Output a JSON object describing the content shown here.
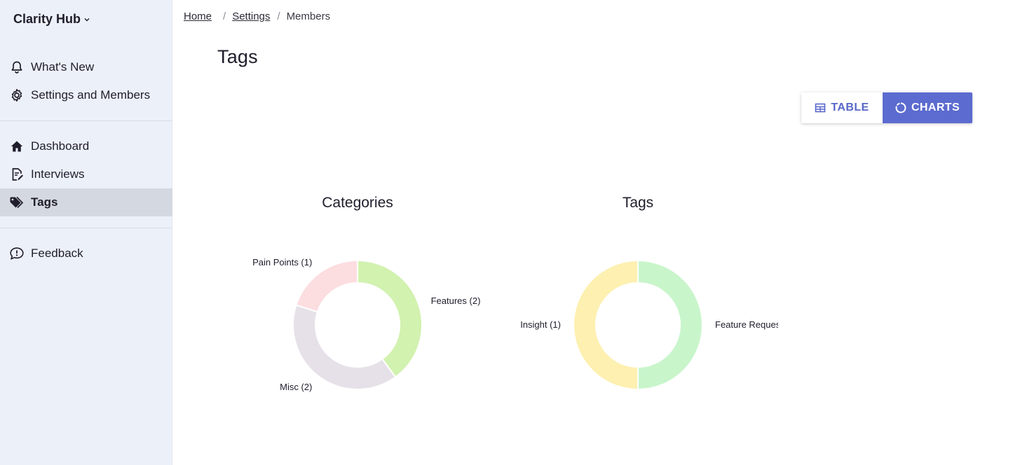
{
  "app": {
    "brand": "Clarity Hub"
  },
  "sidebar": {
    "top_items": [
      {
        "label": "What's New",
        "icon": "bell-icon"
      },
      {
        "label": "Settings and Members",
        "icon": "gear-icon"
      }
    ],
    "main_items": [
      {
        "label": "Dashboard",
        "icon": "home-icon"
      },
      {
        "label": "Interviews",
        "icon": "document-edit-icon"
      },
      {
        "label": "Tags",
        "icon": "tags-icon",
        "active": true
      }
    ],
    "bottom_items": [
      {
        "label": "Feedback",
        "icon": "chat-alert-icon"
      }
    ]
  },
  "breadcrumb": {
    "home": "Home",
    "settings": "Settings",
    "current": "Members",
    "separator": "/"
  },
  "page": {
    "title": "Tags"
  },
  "view_toggle": {
    "table_label": "TABLE",
    "charts_label": "CHARTS",
    "selected": "charts",
    "accent": "#5c6bcf"
  },
  "chart_data": [
    {
      "type": "pie",
      "title": "Categories",
      "labels": [
        "Features (2)",
        "Misc (2)",
        "Pain Points (1)"
      ],
      "categories": [
        "Features",
        "Misc",
        "Pain Points"
      ],
      "values": [
        2,
        2,
        1
      ],
      "colors": [
        "#d2f2b0",
        "#e6e1e8",
        "#fcdde0"
      ]
    },
    {
      "type": "pie",
      "title": "Tags",
      "labels": [
        "Feature Request",
        "Insight (1)"
      ],
      "categories": [
        "Feature Request",
        "Insight"
      ],
      "values": [
        1,
        1
      ],
      "colors": [
        "#c9f5cb",
        "#fdf0b0"
      ]
    }
  ]
}
